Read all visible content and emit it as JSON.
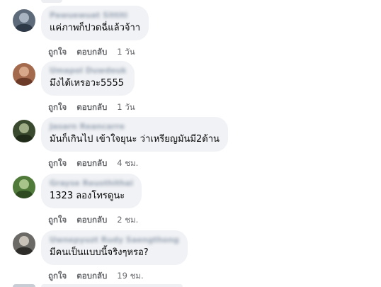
{
  "comments": [
    {
      "author": "Pawuewuat Sittiti",
      "text": "แค่ภาพก็ปวดฉี่แล้วจ้าา",
      "like": "ถูกใจ",
      "reply": "ตอบกลับ",
      "time": "1 วัน",
      "avatar_icon": "profile-photo-icon",
      "avatar_colors": [
        "#5d6a7a",
        "#a9b4c2",
        "#2e3a48"
      ]
    },
    {
      "author": "Umapol Duwdeuk",
      "text": "มึงได้เหรอวะ5555",
      "like": "ถูกใจ",
      "reply": "ตอบกลับ",
      "time": "1 วัน",
      "avatar_icon": "profile-photo-icon",
      "avatar_colors": [
        "#a36a4e",
        "#d8a88a",
        "#6b3b28"
      ]
    },
    {
      "author": "Jasarn Reancarre",
      "text": "มันก็เกินไป เข้าใจยุนะ ว่าเหรียญมันมี2ด้าน",
      "like": "ถูกใจ",
      "reply": "ตอบกลับ",
      "time": "4 ชม.",
      "avatar_icon": "profile-photo-icon",
      "avatar_colors": [
        "#3a4a2e",
        "#9fae86",
        "#1f2a18"
      ]
    },
    {
      "author": "Grayse Reusthithai",
      "text": "1323 ลองโทรดูนะ",
      "like": "ถูกใจ",
      "reply": "ตอบกลับ",
      "time": "2 ชม.",
      "avatar_icon": "profile-photo-icon",
      "avatar_colors": [
        "#4f7a3a",
        "#a7c58a",
        "#2d4a20"
      ]
    },
    {
      "author": "Uwnepyuzt Rudy Saengthong",
      "text": "มีคนเป็นแบบนี้จริงๆหรอ?",
      "like": "ถูกใจ",
      "reply": "ตอบกลับ",
      "time": "19 ชม.",
      "avatar_icon": "profile-photo-icon",
      "avatar_colors": [
        "#6c6a66",
        "#c8c2b8",
        "#2f2d2a"
      ]
    }
  ]
}
